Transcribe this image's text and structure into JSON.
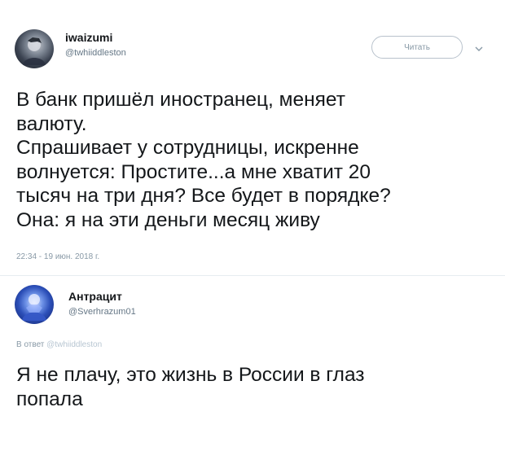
{
  "tweet1": {
    "author_name": "iwaizumi",
    "author_handle": "@twhiiddleston",
    "follow_label": "Читать",
    "body_lines": [
      "В банк пришёл иностранец, меняет",
      "валюту.",
      "Спрашивает у сотрудницы, искренне",
      "волнуется: Простите...а мне хватит 20",
      "тысяч на три дня? Все будет в порядке?",
      "Она: я на эти деньги месяц живу"
    ],
    "timestamp": "22:34 - 19 июн. 2018 г.",
    "avatar_icon": "user-avatar-icon",
    "menu_icon": "chevron-down-icon"
  },
  "tweet2": {
    "author_name": "Антрацит",
    "author_handle": "@Sverhrazum01",
    "reply_prefix": "В ответ",
    "reply_to": "@twhiiddleston",
    "body_lines": [
      "Я не плачу, это жизнь в России в глаз",
      "попала"
    ],
    "avatar_icon": "user-avatar-icon"
  },
  "colors": {
    "text": "#14171a",
    "secondary": "#657786",
    "muted": "#8899a6",
    "border": "#b8c2cc"
  }
}
